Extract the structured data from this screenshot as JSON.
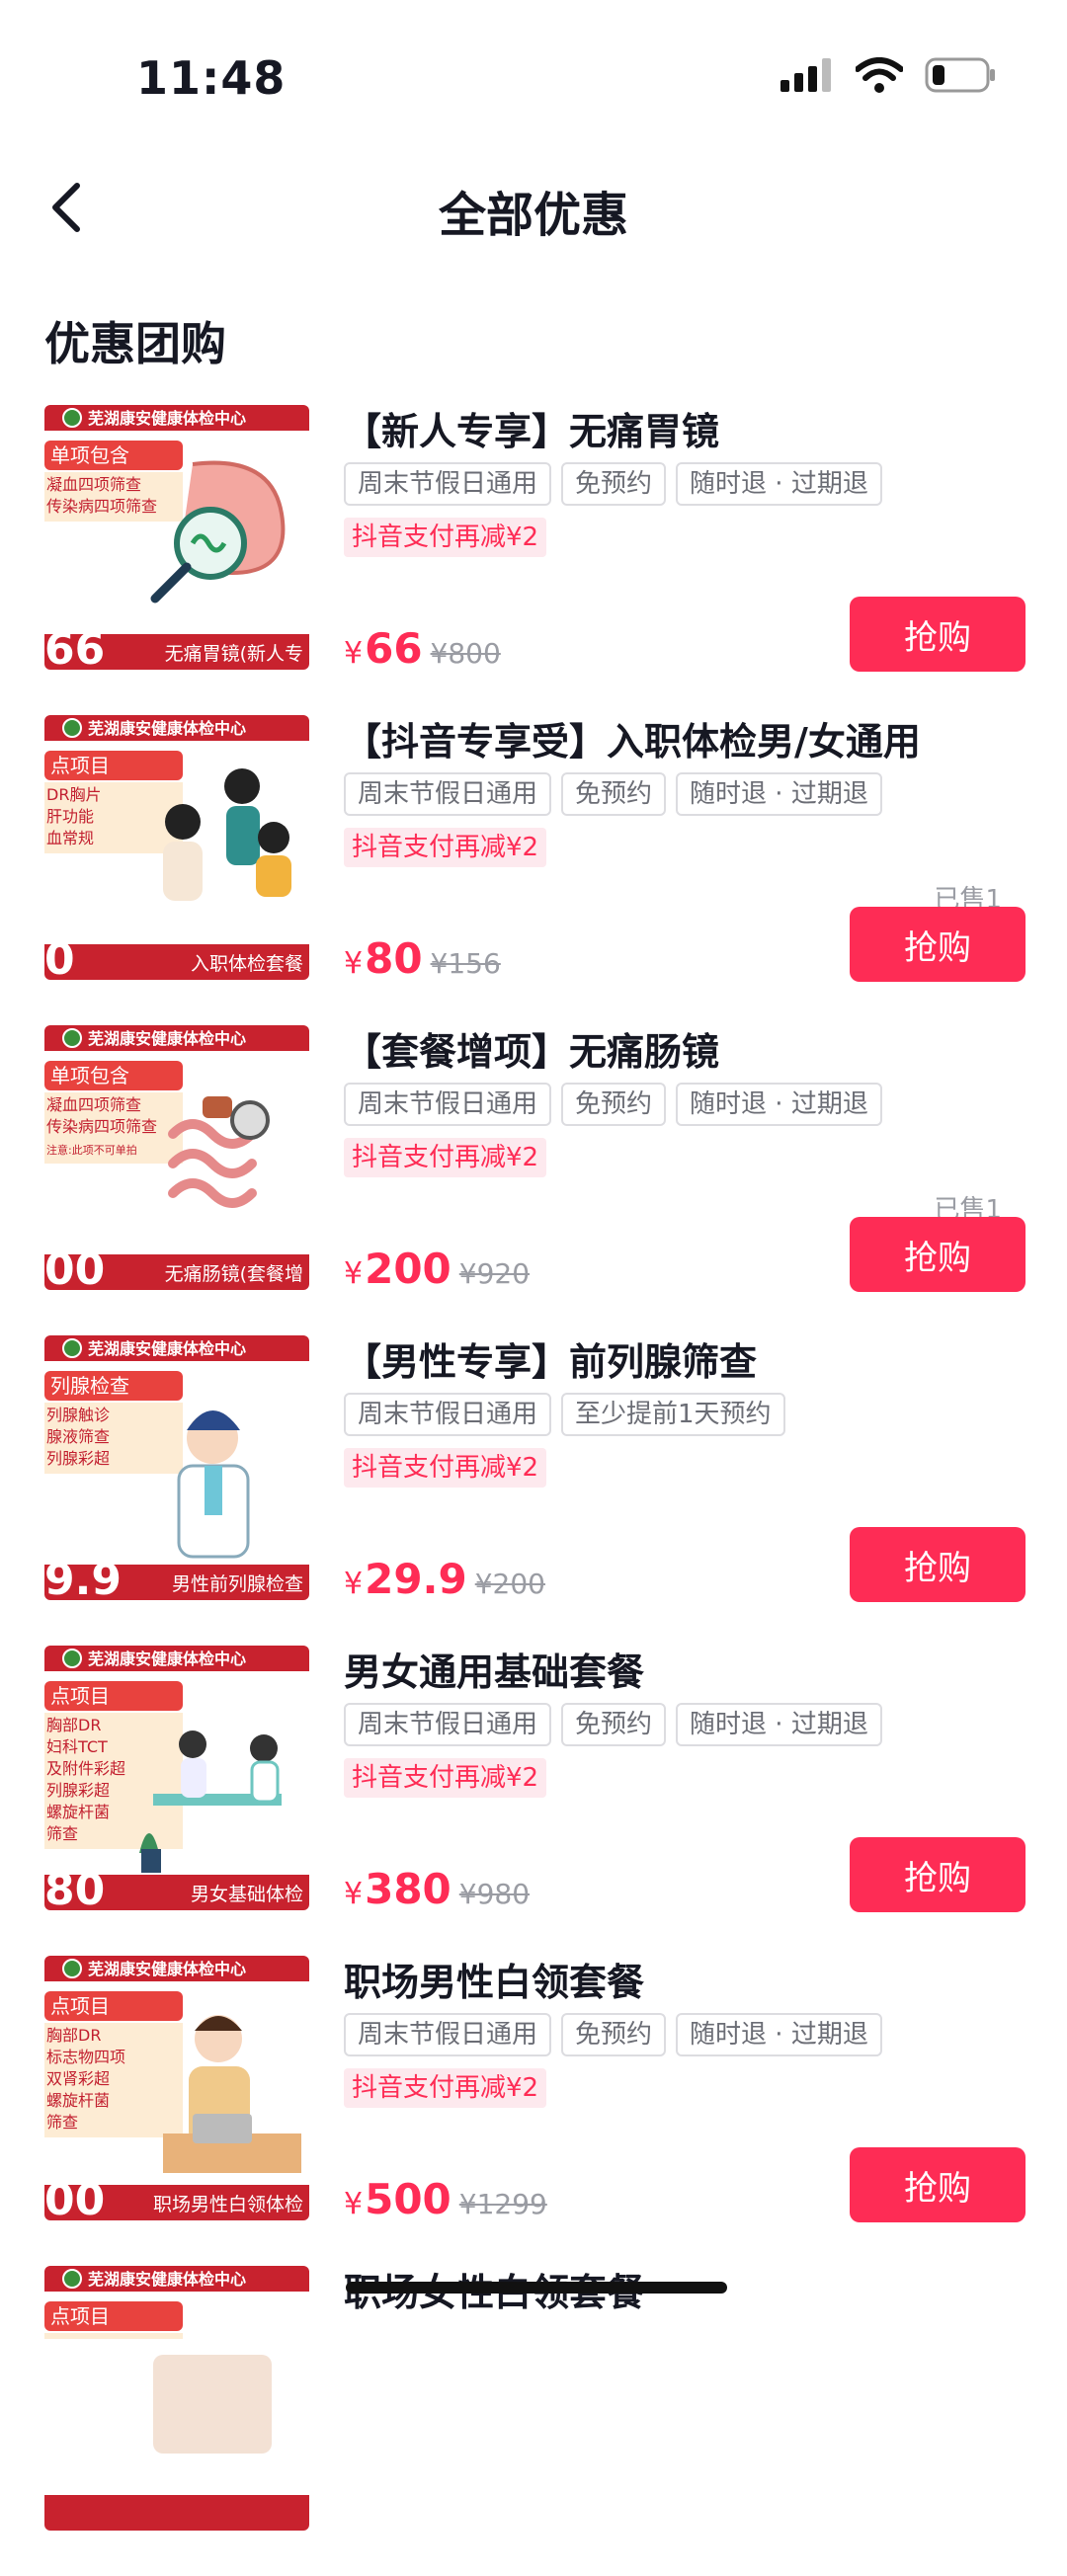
{
  "status": {
    "time": "11:48"
  },
  "nav": {
    "title": "全部优惠"
  },
  "section": {
    "title": "优惠团购"
  },
  "colors": {
    "accent": "#fe2c55",
    "promo_bg": "#fde9ee"
  },
  "items": [
    {
      "title": "【新人专享】无痛胃镜",
      "tags": [
        "周末节假日通用",
        "免预约",
        "随时退 · 过期退"
      ],
      "promo": "抖音支付再减¥2",
      "sold": "",
      "currency": "¥",
      "price": "66",
      "orig": "¥800",
      "buy": "抢购",
      "thumb": {
        "header": "芜湖康安健康体检中心",
        "badge": "单项包含",
        "lines": [
          "凝血四项筛查",
          "传染病四项筛查"
        ],
        "big": "66",
        "footer": "无痛胃镜(新人专",
        "icon": "stomach-illustration-icon"
      }
    },
    {
      "title": "【抖音专享受】入职体检男/女通用",
      "tags": [
        "周末节假日通用",
        "免预约",
        "随时退 · 过期退"
      ],
      "promo": "抖音支付再减¥2",
      "sold": "已售1",
      "currency": "¥",
      "price": "80",
      "orig": "¥156",
      "buy": "抢购",
      "thumb": {
        "header": "芜湖康安健康体检中心",
        "badge": "点项目",
        "lines": [
          "DR胸片",
          "肝功能",
          "血常规"
        ],
        "big": "0",
        "footer": "入职体检套餐",
        "icon": "people-illustration-icon"
      }
    },
    {
      "title": "【套餐增项】无痛肠镜",
      "tags": [
        "周末节假日通用",
        "免预约",
        "随时退 · 过期退"
      ],
      "promo": "抖音支付再减¥2",
      "sold": "已售1",
      "currency": "¥",
      "price": "200",
      "orig": "¥920",
      "buy": "抢购",
      "thumb": {
        "header": "芜湖康安健康体检中心",
        "badge": "单项包含",
        "lines": [
          "凝血四项筛查",
          "传染病四项筛查",
          "注意:此项不可单拍"
        ],
        "big": "00",
        "footer": "无痛肠镜(套餐增",
        "icon": "intestine-illustration-icon"
      }
    },
    {
      "title": "【男性专享】前列腺筛查",
      "tags": [
        "周末节假日通用",
        "至少提前1天预约"
      ],
      "promo": "抖音支付再减¥2",
      "sold": "",
      "currency": "¥",
      "price": "29.9",
      "orig": "¥200",
      "buy": "抢购",
      "thumb": {
        "header": "芜湖康安健康体检中心",
        "badge": "列腺检查",
        "lines": [
          "列腺触诊",
          "腺液筛查",
          "列腺彩超"
        ],
        "big": "9.9",
        "footer": "男性前列腺检查",
        "icon": "doctor-illustration-icon"
      }
    },
    {
      "title": "男女通用基础套餐",
      "tags": [
        "周末节假日通用",
        "免预约",
        "随时退 · 过期退"
      ],
      "promo": "抖音支付再减¥2",
      "sold": "",
      "currency": "¥",
      "price": "380",
      "orig": "¥980",
      "buy": "抢购",
      "thumb": {
        "header": "芜湖康安健康体检中心",
        "badge": "点项目",
        "lines": [
          "胸部DR",
          "妇科TCT",
          "及附件彩超",
          "列腺彩超",
          "螺旋杆菌",
          "筛查"
        ],
        "big": "80",
        "footer": "男女基础体检",
        "icon": "consultation-illustration-icon"
      }
    },
    {
      "title": "职场男性白领套餐",
      "tags": [
        "周末节假日通用",
        "免预约",
        "随时退 · 过期退"
      ],
      "promo": "抖音支付再减¥2",
      "sold": "",
      "currency": "¥",
      "price": "500",
      "orig": "¥1299",
      "buy": "抢购",
      "thumb": {
        "header": "芜湖康安健康体检中心",
        "badge": "点项目",
        "lines": [
          "胸部DR",
          "标志物四项",
          "双肾彩超",
          "螺旋杆菌",
          "筛查"
        ],
        "big": "00",
        "footer": "职场男性白领体检",
        "icon": "office-man-illustration-icon"
      }
    },
    {
      "title": "职场女性白领套餐",
      "tags": [],
      "promo": "",
      "sold": "",
      "currency": "",
      "price": "",
      "orig": "",
      "buy": "",
      "thumb": {
        "header": "芜湖康安健康体检中心",
        "badge": "点项目",
        "lines": [],
        "big": "",
        "footer": "",
        "icon": "office-woman-illustration-icon"
      }
    }
  ]
}
